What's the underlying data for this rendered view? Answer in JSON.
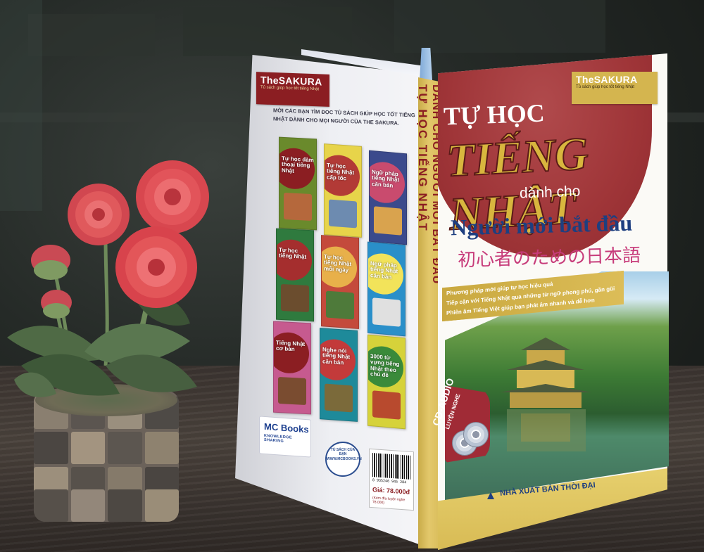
{
  "colors": {
    "cover_red": "#9f3538",
    "cover_gold": "#d4b54f",
    "title_blue": "#1e3f80",
    "spine_gold": "#e3c86b",
    "flower_red": "#e2545a"
  },
  "book": {
    "brand": "TheSAKURA",
    "brand_tagline": "Tủ sách giúp học tốt tiếng Nhật",
    "front": {
      "title_line1": "TỰ HỌC",
      "title_line2": "TIẾNG NHẬT",
      "title_line3": "dành cho",
      "subtitle": "Người mới bắt đầu",
      "japanese": "初心者のための日本語",
      "tagline_lines": [
        "Phương pháp mới giúp tự học hiệu quả",
        "Tiếp cận với Tiếng Nhật qua những từ ngữ phong phú, gần gũi",
        "Phiên âm Tiếng Việt giúp bạn phát âm nhanh và dễ hơn"
      ],
      "cd_badge_line1": "CD-AUDIO",
      "cd_badge_line2": "LUYỆN NGHE",
      "publisher": "NHÀ XUẤT BẢN THỜI ĐẠI"
    },
    "spine": {
      "left_text": "TỰ HỌC TIẾNG NHẬT",
      "right_text": "DÀNH CHO NGƯỜI MỚI BẮT ĐẦU"
    },
    "back": {
      "intro": "MỜI CÁC BẠN TÌM ĐỌC TỦ SÁCH GIÚP HỌC TỐT TIẾNG NHẬT DÀNH CHO MỌI NGƯỜI CỦA THE SAKURA.",
      "thumbnails": [
        {
          "title": "Tự học đàm thoại tiếng Nhật",
          "color": "#6a8a2c",
          "blob": "#8b1e22",
          "img": "#b5683c"
        },
        {
          "title": "Tự học tiếng Nhật cấp tốc",
          "color": "#e7d44a",
          "blob": "#b23a36",
          "img": "#6d8bb0"
        },
        {
          "title": "Ngữ pháp tiếng Nhật căn bản",
          "color": "#3b4a8c",
          "blob": "#c94b6e",
          "img": "#d9a34e"
        },
        {
          "title": "Tự học tiếng Nhật",
          "color": "#2f7a3e",
          "blob": "#a52e2e",
          "img": "#6b4d2e"
        },
        {
          "title": "Tự học tiếng Nhật mỗi ngày",
          "color": "#c44a3c",
          "blob": "#e8b04a",
          "img": "#4e7a3a"
        },
        {
          "title": "Ngữ pháp tiếng Nhật căn bản",
          "color": "#2a8fc9",
          "blob": "#f2e35a",
          "img": "#e0e0e0"
        },
        {
          "title": "Tiếng Nhật cơ bản",
          "color": "#c65a8f",
          "blob": "#8b1e22",
          "img": "#7a4c30"
        },
        {
          "title": "Nghe nói tiếng Nhật căn bản",
          "color": "#1e8a9a",
          "blob": "#c33a3a",
          "img": "#7b6a3a"
        },
        {
          "title": "3000 từ vựng tiếng Nhật theo chủ đề",
          "color": "#d6d23a",
          "blob": "#3a8a3a",
          "img": "#b84a2e"
        }
      ],
      "logo_name": "MC Books",
      "logo_tagline": "KNOWLEDGE SHARING",
      "stamp_top": "TỦ SÁCH CỦA BẠN",
      "stamp_url": "WWW.MCBOOKS.VN",
      "barcode_digits": "8 935246 945 284",
      "price": "Giá: 78.000đ",
      "price_note": "(Kèm đĩa luyện nghe 78.000)"
    }
  }
}
